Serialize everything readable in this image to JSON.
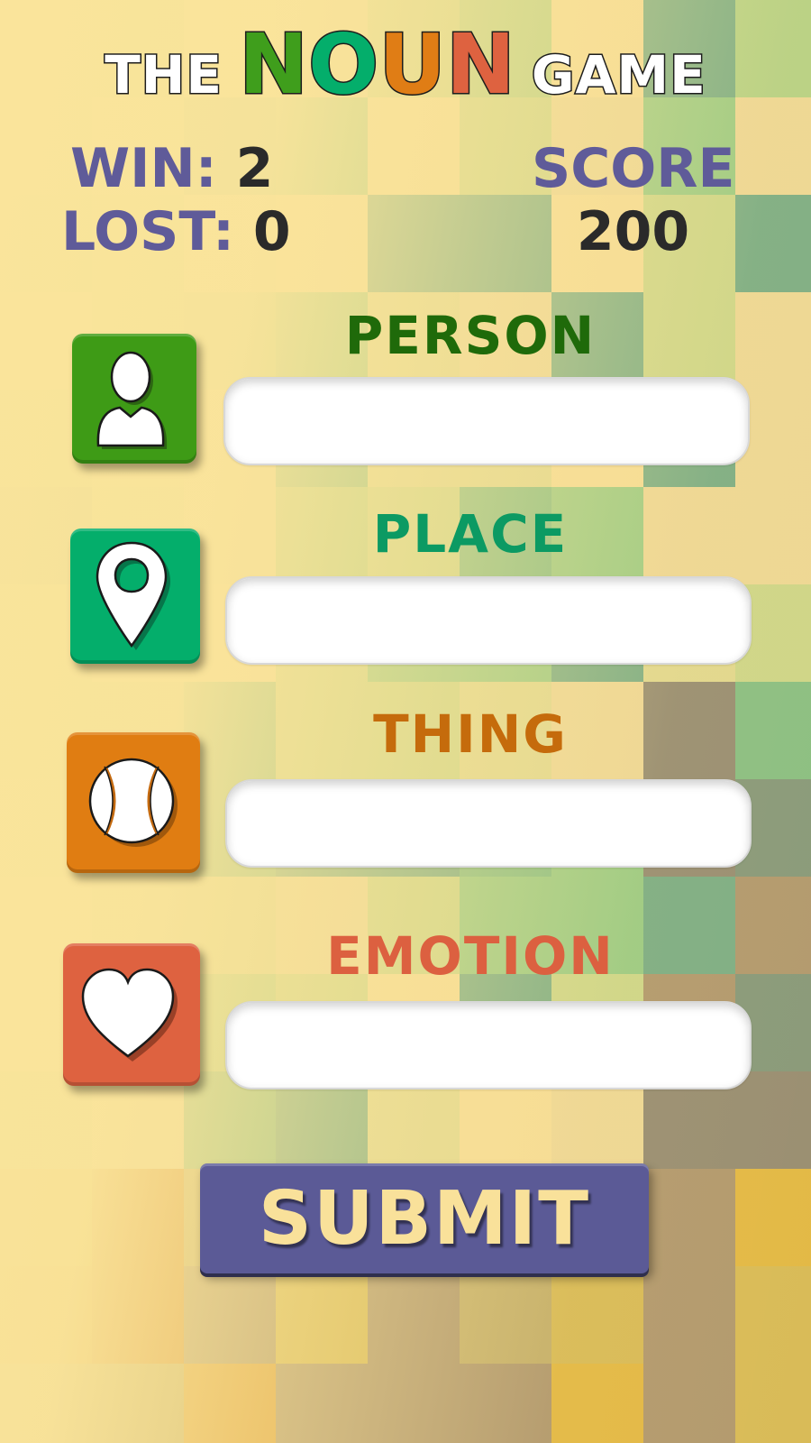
{
  "title": {
    "prefix": "THE",
    "highlight_letters": [
      {
        "char": "N",
        "color": "#3f9e1c"
      },
      {
        "char": "O",
        "color": "#04ae6b"
      },
      {
        "char": "U",
        "color": "#e07d15"
      },
      {
        "char": "N",
        "color": "#de6240"
      }
    ],
    "suffix": "GAME"
  },
  "stats": {
    "win_label": "WIN:",
    "win_value": "2",
    "lost_label": "LOST:",
    "lost_value": "0",
    "score_label": "SCORE",
    "score_value": "200"
  },
  "categories": [
    {
      "label": "PERSON",
      "color": "#3e9b16",
      "label_color": "#1f6a0a",
      "icon": "person-icon",
      "value": "",
      "placeholder": ""
    },
    {
      "label": "PLACE",
      "color": "#04ae6b",
      "label_color": "#0c9a63",
      "icon": "map-pin-icon",
      "value": "",
      "placeholder": ""
    },
    {
      "label": "THING",
      "color": "#e07d12",
      "label_color": "#c56b0c",
      "icon": "baseball-icon",
      "value": "",
      "placeholder": ""
    },
    {
      "label": "EMOTION",
      "color": "#de6240",
      "label_color": "#dc6040",
      "icon": "heart-icon",
      "value": "",
      "placeholder": ""
    }
  ],
  "submit_label": "SUBMIT",
  "colors": {
    "background": "#f8e19a",
    "stat_label": "#5f5b99",
    "stat_value": "#2a2a2a",
    "submit_bg": "#5b5a96",
    "submit_text": "#f9e19a"
  }
}
